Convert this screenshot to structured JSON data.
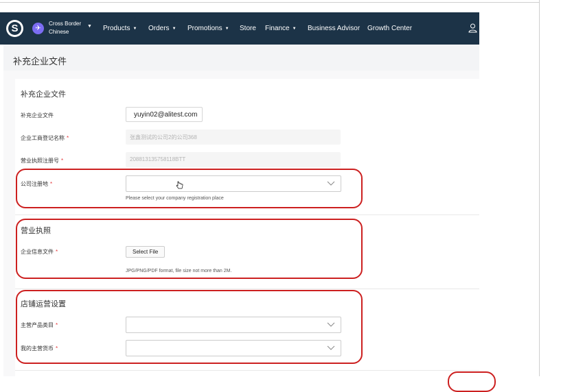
{
  "nav": {
    "logo_glyph": "S",
    "region_line1": "Cross Border",
    "region_line2": "Chinese",
    "items": [
      {
        "label": "Products",
        "has_caret": true
      },
      {
        "label": "Orders",
        "has_caret": true
      },
      {
        "label": "Promotions",
        "has_caret": true
      },
      {
        "label": "Store",
        "has_caret": false
      },
      {
        "label": "Finance",
        "has_caret": true
      },
      {
        "label": "Business Advisor",
        "has_caret": false
      },
      {
        "label": "Growth Center",
        "has_caret": false
      }
    ],
    "caret_glyph": "▼",
    "user_icon": "user-icon"
  },
  "page": {
    "title": "补充企业文件"
  },
  "section_docs": {
    "title": "补充企业文件",
    "email_label": "补充企业文件",
    "email_value": "yuyin02@alitest.com",
    "company_name_label": "企业工商登记名称",
    "company_name_value": "张鑫测试的公司2的公司368",
    "license_no_label": "营业执照注册号",
    "license_no_value": "208813135758118BTT",
    "reg_place_label": "公司注册地",
    "reg_place_value": "",
    "reg_place_hint": "Please select your company registration place",
    "required_mark": "*"
  },
  "section_license": {
    "title": "营业执照",
    "file_label": "企业信息文件",
    "file_button": "Select File",
    "file_hint": "JPG/PNG/PDF format, file size not more than 2M."
  },
  "section_store": {
    "title": "店铺运营设置",
    "category_label": "主营产品类目",
    "category_value": "",
    "currency_label": "我的主营货币",
    "currency_value": ""
  },
  "colors": {
    "nav_bg": "#1c3347",
    "highlight": "#cc1f1f",
    "required": "#e4393c",
    "region_icon": "#7b6cf2"
  }
}
